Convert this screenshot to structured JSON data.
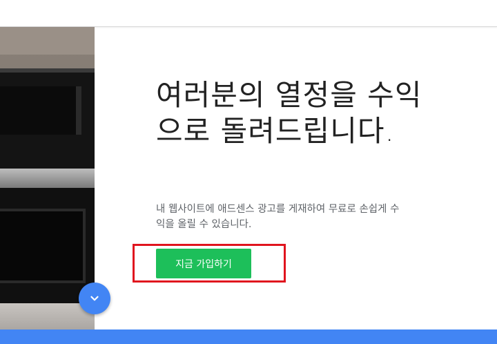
{
  "hero": {
    "headline": "여러분의 열정을 수익으로 돌려드립니다.",
    "subtext": "내 웹사이트에 애드센스 광고를 게재하여 무료로 손쉽게 수익을 올릴 수 있습니다.",
    "cta_label": "지금 가입하기"
  },
  "scroll_button": {
    "icon": "chevron-down-icon"
  },
  "colors": {
    "cta": "#1dbf5a",
    "accent_blue": "#4285f4",
    "highlight": "#e0141e"
  }
}
